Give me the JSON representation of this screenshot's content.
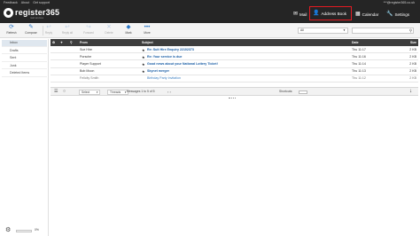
{
  "header": {
    "links": [
      "Feedback",
      "About",
      "Get support"
    ],
    "email": "***@register365.co.uk",
    "logo_text": "register365",
    "logo_sub": "mail services",
    "tabs": [
      {
        "label": "Mail",
        "icon": "envelope-icon"
      },
      {
        "label": "Address Book",
        "icon": "person-icon"
      },
      {
        "label": "Calendar",
        "icon": "calendar-icon"
      },
      {
        "label": "Settings",
        "icon": "wrench-icon"
      }
    ],
    "highlight_color": "#e41b23"
  },
  "toolbar": {
    "buttons": [
      {
        "label": "Refresh",
        "icon": "refresh-icon",
        "enabled": true
      },
      {
        "label": "Compose",
        "icon": "compose-icon",
        "enabled": true
      },
      {
        "label": "Reply",
        "icon": "reply-icon",
        "enabled": false
      },
      {
        "label": "Reply all",
        "icon": "reply-all-icon",
        "enabled": false
      },
      {
        "label": "Forward",
        "icon": "forward-icon",
        "enabled": false
      },
      {
        "label": "Delete",
        "icon": "delete-icon",
        "enabled": false
      },
      {
        "label": "Mark",
        "icon": "tag-icon",
        "enabled": true
      },
      {
        "label": "More",
        "icon": "more-icon",
        "enabled": true
      }
    ],
    "filter_value": "All",
    "search_value": ""
  },
  "sidebar": {
    "folders": [
      "Inbox",
      "Drafts",
      "Sent",
      "Junk",
      "Deleted Items"
    ],
    "active_folder": "Inbox",
    "quota_text": "0%",
    "quota_fraction": 0.0
  },
  "message_list": {
    "columns": {
      "from": "From",
      "subject": "Subject",
      "date": "Date",
      "size": "Size"
    },
    "rows": [
      {
        "from": "Sue Hire",
        "subject": "Re: Suit Hire Enquiry 22102373",
        "date": "Thu 11:17",
        "size": "2 KB",
        "read": false
      },
      {
        "from": "Porsche",
        "subject": "Re: Your service is due",
        "date": "Thu 11:16",
        "size": "2 KB",
        "read": false
      },
      {
        "from": "Player Support",
        "subject": "Good news about your National Lottery Ticket!",
        "date": "Thu 11:14",
        "size": "2 KB",
        "read": false
      },
      {
        "from": "Bob Moon",
        "subject": "Skynet merger",
        "date": "Thu 11:13",
        "size": "2 KB",
        "read": false
      },
      {
        "from": "Felicity Smith",
        "subject": "Birthday Party Invitation",
        "date": "Thu 11:12",
        "size": "2 KB",
        "read": true
      }
    ]
  },
  "list_footer": {
    "select_label": "Select",
    "threads_label": "Threads",
    "count_text": "Messages 1 to 5 of 5",
    "shortcuts_label": "Shortcuts:"
  }
}
